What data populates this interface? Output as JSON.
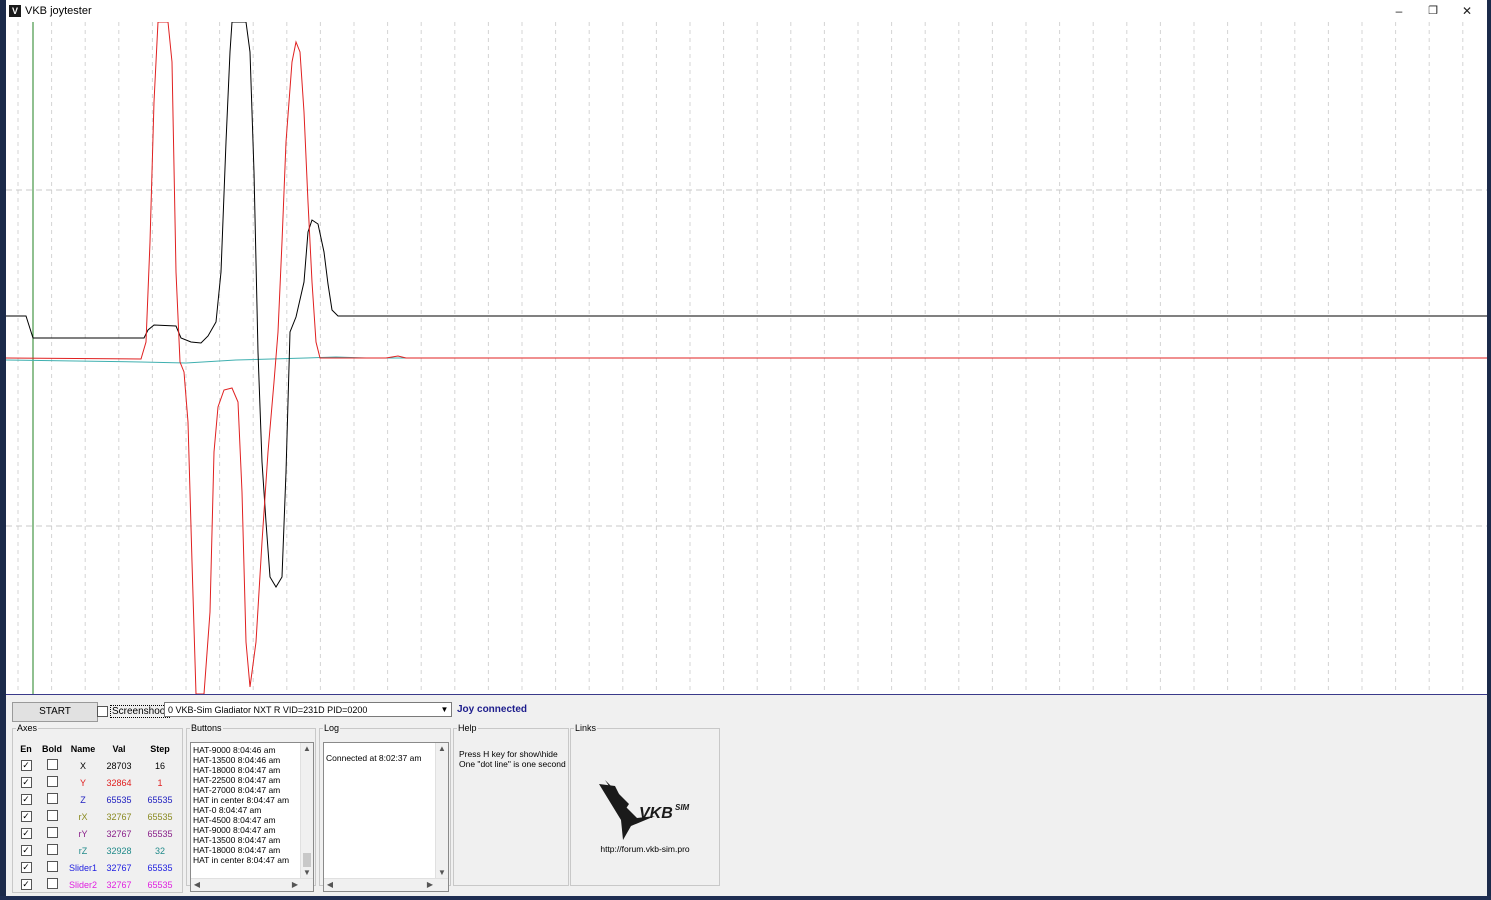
{
  "window": {
    "title": "VKB joytester",
    "icon_name": "vkb-app-icon",
    "controls": {
      "minimize": "–",
      "maximize": "❐",
      "close": "✕"
    }
  },
  "toolbar": {
    "start_label": "START",
    "screenshoot_checked": false,
    "screenshoot_label": "Screenshoot",
    "device_selected": "0  VKB-Sim Gladiator NXT R   VID=231D PID=0200",
    "status": "Joy connected",
    "status_color": "#1c1c8c"
  },
  "axes": {
    "legend": "Axes",
    "headers": {
      "en": "En",
      "bold": "Bold",
      "name": "Name",
      "val": "Val",
      "step": "Step"
    },
    "rows": [
      {
        "en": true,
        "bold": false,
        "name": "X",
        "val": "28703",
        "step": "16",
        "color": "#000000"
      },
      {
        "en": true,
        "bold": false,
        "name": "Y",
        "val": "32864",
        "step": "1",
        "color": "#e02020"
      },
      {
        "en": true,
        "bold": false,
        "name": "Z",
        "val": "65535",
        "step": "65535",
        "color": "#2020c0"
      },
      {
        "en": true,
        "bold": false,
        "name": "rX",
        "val": "32767",
        "step": "65535",
        "color": "#8a8a20"
      },
      {
        "en": true,
        "bold": false,
        "name": "rY",
        "val": "32767",
        "step": "65535",
        "color": "#8a208a"
      },
      {
        "en": true,
        "bold": false,
        "name": "rZ",
        "val": "32928",
        "step": "32",
        "color": "#208a8a"
      },
      {
        "en": true,
        "bold": false,
        "name": "Slider1",
        "val": "32767",
        "step": "65535",
        "color": "#2020e0"
      },
      {
        "en": true,
        "bold": false,
        "name": "Slider2",
        "val": "32767",
        "step": "65535",
        "color": "#e020e0"
      }
    ]
  },
  "buttons_panel": {
    "legend": "Buttons",
    "lines": [
      "HAT-9000 8:04:46 am",
      "HAT-13500 8:04:46 am",
      "HAT-18000 8:04:47 am",
      "HAT-22500 8:04:47 am",
      "HAT-27000 8:04:47 am",
      "HAT in center 8:04:47 am",
      "HAT-0 8:04:47 am",
      "HAT-4500 8:04:47 am",
      "HAT-9000 8:04:47 am",
      "HAT-13500 8:04:47 am",
      "HAT-18000 8:04:47 am",
      "HAT in center 8:04:47 am"
    ]
  },
  "log_panel": {
    "legend": "Log",
    "lines": [
      "Connected at 8:02:37 am"
    ]
  },
  "help_panel": {
    "legend": "Help",
    "lines": [
      "Press H key for show\\hide",
      "One \"dot line\" is one second"
    ]
  },
  "links_panel": {
    "legend": "Links",
    "logo_text": "VKB",
    "logo_suffix": "SIM",
    "url": "http://forum.vkb-sim.pro"
  }
}
